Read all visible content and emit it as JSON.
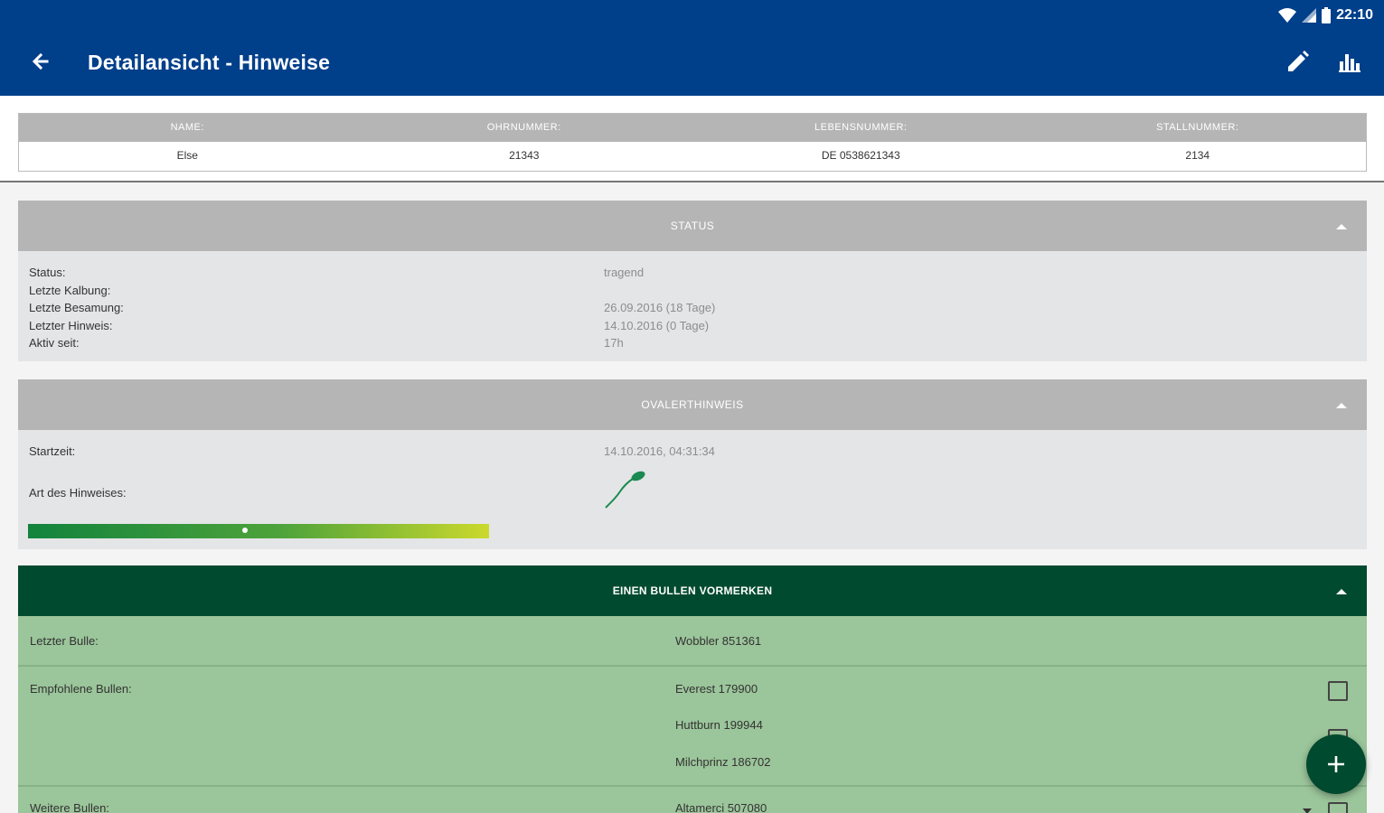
{
  "statusbar": {
    "time": "22:10"
  },
  "appbar": {
    "title": "Detailansicht - Hinweise"
  },
  "info": {
    "headers": [
      "NAME:",
      "OHRNUMMER:",
      "LEBENSNUMMER:",
      "STALLNUMMER:"
    ],
    "values": [
      "Else",
      "21343",
      "DE 0538621343",
      "2134"
    ]
  },
  "status": {
    "heading": "STATUS",
    "labels": [
      "Status:",
      "Letzte Kalbung:",
      "Letzte Besamung:",
      "Letzter Hinweis:",
      "Aktiv seit:"
    ],
    "values": [
      "tragend",
      "",
      "26.09.2016 (18 Tage)",
      "14.10.2016 (0 Tage)",
      "17h"
    ]
  },
  "ovulation": {
    "heading": "OVALERTHINWEIS",
    "start_label": "Startzeit:",
    "start_value": "14.10.2016, 04:31:34",
    "type_label": "Art des Hinweises:",
    "type_icon": "sperm-icon",
    "progress_marker": 0.47
  },
  "bull": {
    "heading": "EINEN BULLEN VORMERKEN",
    "last_label": "Letzter Bulle:",
    "last_value": "Wobbler 851361",
    "recommended_label": "Empfohlene Bullen:",
    "recommended": [
      "Everest 179900",
      "Huttburn 199944",
      "Milchprinz 186702"
    ],
    "more_label": "Weitere Bullen:",
    "more_value": "Altamerci 507080"
  },
  "colors": {
    "appbar": "#003f8a",
    "section_gray": "#b5b5b5",
    "section_green": "#004a30",
    "body_green": "#9bc59a"
  },
  "icons": [
    "back-arrow-icon",
    "edit-pencil-icon",
    "bar-chart-icon",
    "wifi-icon",
    "signal-icon",
    "battery-icon",
    "chevron-up-icon",
    "plus-icon"
  ]
}
